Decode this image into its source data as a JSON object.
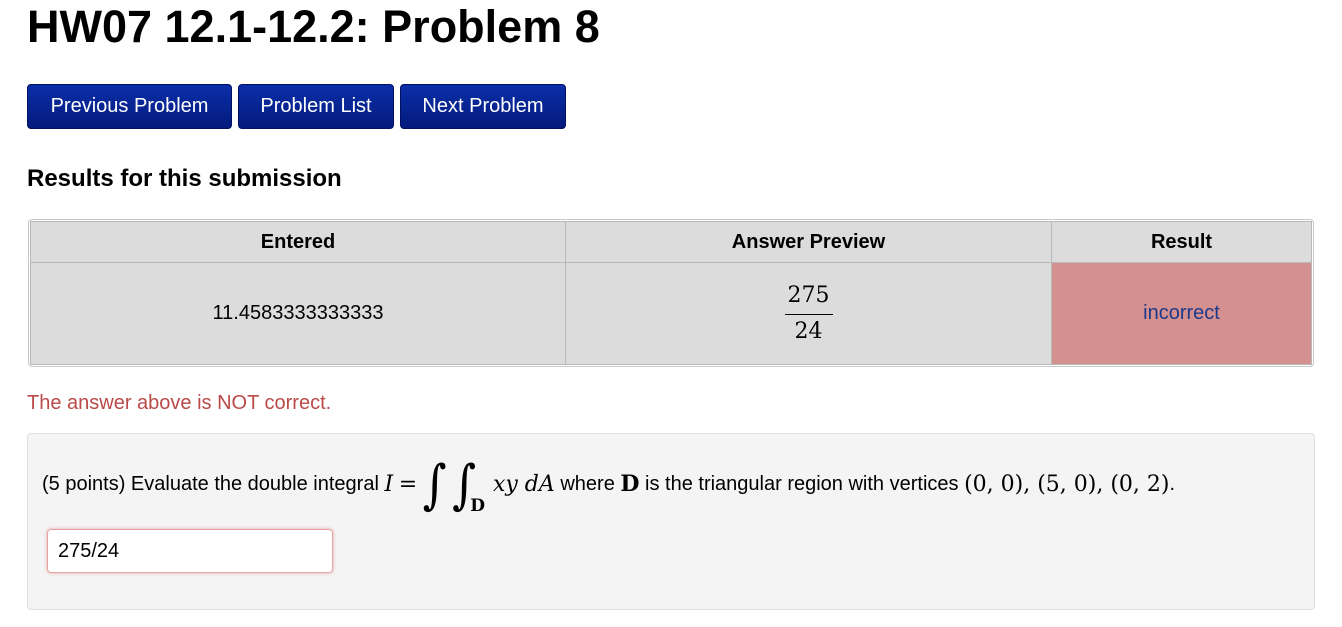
{
  "page": {
    "title": "HW07 12.1-12.2: Problem 8"
  },
  "nav": {
    "previous": "Previous Problem",
    "list": "Problem List",
    "next": "Next Problem"
  },
  "results": {
    "heading": "Results for this submission",
    "columns": [
      "Entered",
      "Answer Preview",
      "Result"
    ],
    "row": {
      "entered": "11.4583333333333",
      "preview_numerator": "275",
      "preview_denominator": "24",
      "result": "incorrect"
    },
    "feedback": "The answer above is NOT correct."
  },
  "problem": {
    "points": "(5 points) Evaluate the double integral",
    "math_I": "I",
    "math_eq": "=",
    "integral": "∫",
    "region_sub": "D",
    "integrand": "xy dA",
    "where": "where",
    "region": "D",
    "region_text": "is the triangular region with vertices",
    "vertices": "(0, 0), (5, 0), (0, 2)",
    "period": ".",
    "answer_value": "275/24"
  },
  "colors": {
    "nav_button": "#08289a",
    "incorrect_bg": "#d48f8f",
    "incorrect_text": "#1d3a8a",
    "feedback_text": "#b94a48"
  }
}
